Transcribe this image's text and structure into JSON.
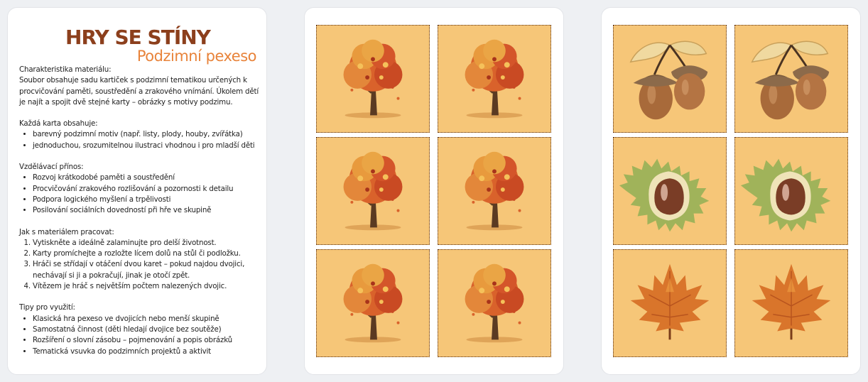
{
  "title": "HRY SE STÍNY",
  "subtitle": "Podzimní pexeso",
  "intro_heading": "Charakteristika materiálu:",
  "intro_text": "Soubor obsahuje sadu kartiček s podzimní tematikou určených k procvičování paměti, soustředění a zrakového vnímání. Úkolem dětí je najít a spojit dvě stejné karty – obrázky s motivy podzimu.",
  "card_heading": "Každá karta obsahuje:",
  "card_items": [
    "barevný podzimní motiv (např. listy, plody, houby, zvířátka)",
    "jednoduchou, srozumitelnou ilustraci vhodnou i pro mladší děti"
  ],
  "benefit_heading": "Vzdělávací přínos:",
  "benefit_items": [
    "Rozvoj krátkodobé paměti a soustředění",
    "Procvičování zrakového rozlišování a pozornosti k detailu",
    "Podpora logického myšlení a trpělivosti",
    "Posilování sociálních dovedností při hře ve skupině"
  ],
  "howto_heading": "Jak s materiálem pracovat:",
  "howto_items": [
    "Vytiskněte a ideálně zalaminujte pro delší životnost.",
    "Karty promíchejte a rozložte lícem dolů na stůl či podložku.",
    "Hráči se střídají v otáčení dvou karet – pokud najdou dvojici, nechávají si ji a pokračují, jinak je otočí zpět.",
    "Vítězem je hráč s největším počtem nalezených dvojic."
  ],
  "tips_heading": "Tipy pro využití:",
  "tips_items": [
    "Klasická hra pexeso ve dvojicích nebo menší skupině",
    "Samostatná činnost (děti hledají dvojice bez soutěže)",
    "Rozšíření o slovní zásobu – pojmenování a popis obrázků",
    "Tematická vsuvka do podzimních projektů a aktivit"
  ],
  "colors": {
    "title": "#8c3f1c",
    "subtitle": "#e8833a",
    "card_bg": "#f6c678"
  },
  "cards_panel2": [
    "tree-card",
    "tree-card",
    "tree-card",
    "tree-card",
    "tree-card",
    "tree-card"
  ],
  "cards_panel3": [
    "acorn-card",
    "acorn-card",
    "chestnut-card",
    "chestnut-card",
    "maple-leaf-card",
    "maple-leaf-card"
  ]
}
